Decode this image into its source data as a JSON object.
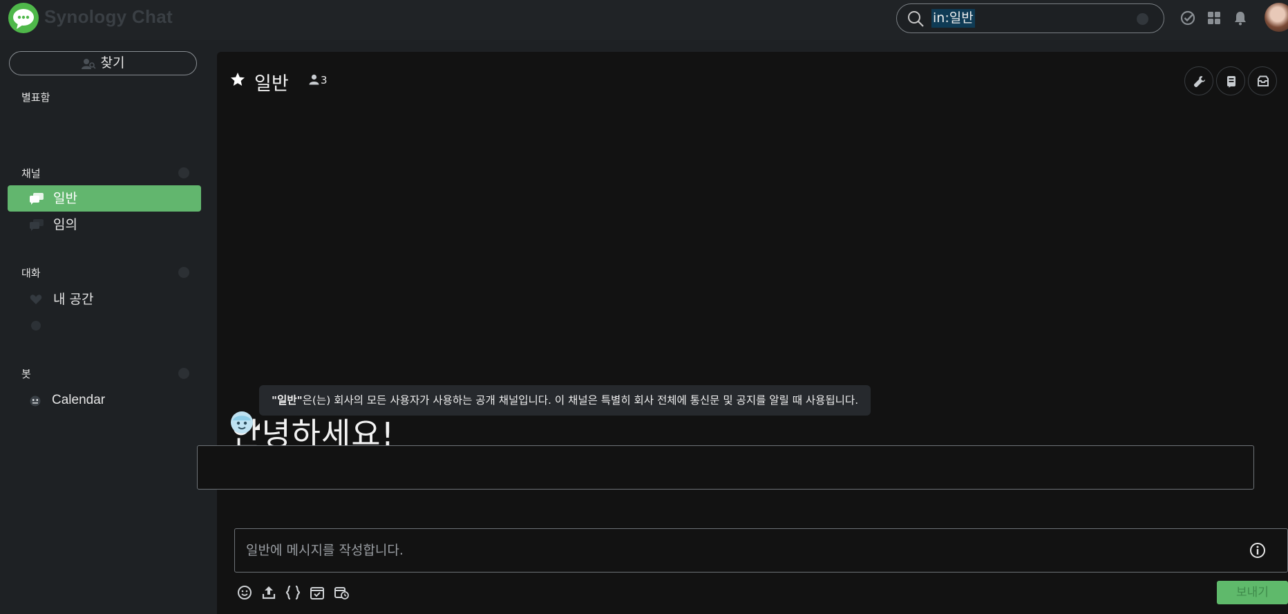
{
  "app": {
    "title": "Synology Chat"
  },
  "search": {
    "query": "in:일반"
  },
  "sidebar": {
    "find_label": "찾기",
    "sections": {
      "starred": "별표함",
      "channels": "채널",
      "conversations": "대화",
      "bots": "봇"
    },
    "channels": [
      {
        "label": "일반",
        "active": true
      },
      {
        "label": "임의",
        "active": false
      }
    ],
    "conversations": [
      {
        "label": "내 공간"
      }
    ],
    "bots": [
      {
        "label": "Calendar"
      }
    ]
  },
  "channel": {
    "name": "일반",
    "member_count": "3",
    "welcome": "안녕하세요!",
    "intro_bold": "\"일반\"",
    "intro_rest": "은(는) 회사의 모든 사용자가 사용하는 공개 채널입니다. 이 채널은 특별히 회사 전체에 통신문 및 공지를 알릴 때 사용됩니다."
  },
  "composer": {
    "placeholder": "일반에 메시지를 작성합니다.",
    "send_label": "보내기"
  },
  "colors": {
    "accent": "#62b66e",
    "logo": "#4fb84a",
    "background": "#121212",
    "sidebar": "#1e2124"
  }
}
